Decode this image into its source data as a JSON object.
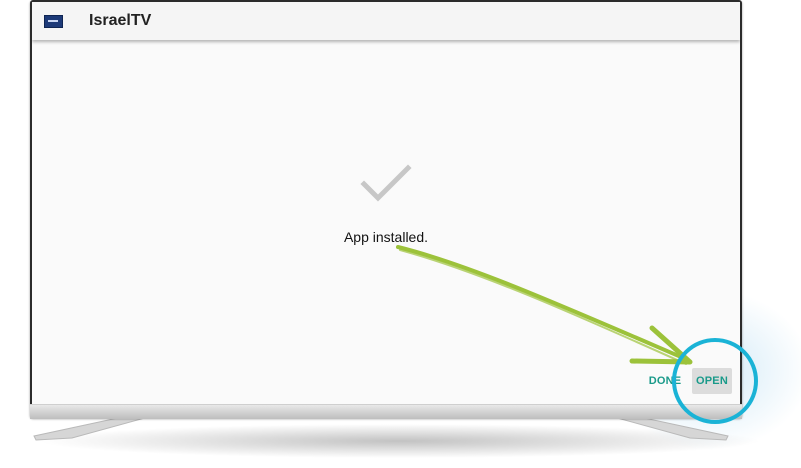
{
  "app_bar": {
    "title": "IsraelTV",
    "icon": "israeltv-app-icon"
  },
  "main": {
    "status_icon": "checkmark-icon",
    "status_text": "App installed."
  },
  "actions": {
    "done_label": "DONE",
    "open_label": "OPEN"
  },
  "colors": {
    "accent": "#1a9a8a",
    "highlight_circle": "#1ab3d6",
    "annotation_arrow": "#9cc23a",
    "checkmark": "#c7c7c7"
  }
}
